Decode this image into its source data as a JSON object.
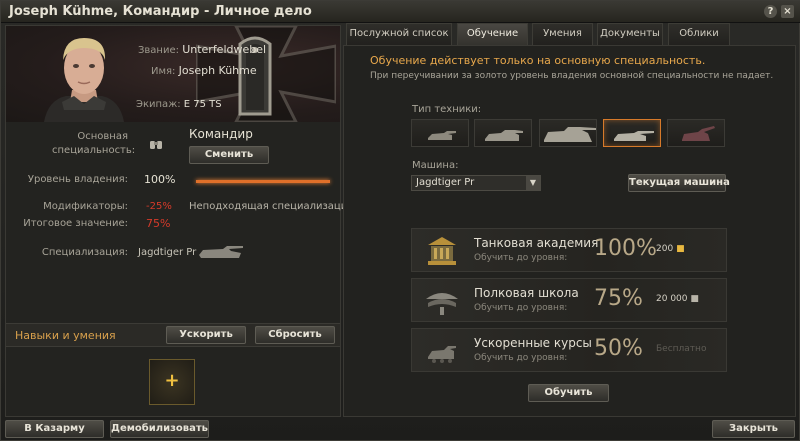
{
  "window": {
    "title": "Joseph Kühme, Командир - Личное дело",
    "help": "?",
    "close": "×"
  },
  "profile": {
    "rank_label": "Звание:",
    "rank": "Unterfeldwebel",
    "name_label": "Имя:",
    "name": "Joseph Kühme",
    "crew_label": "Экипаж:",
    "crew": "E 75 TS"
  },
  "specialty": {
    "label": "Основная специальность:",
    "value": "Командир",
    "change_button": "Сменить",
    "level_label": "Уровень владения:",
    "level": "100%",
    "level_fraction": 1.0,
    "modifiers_label": "Модификаторы:",
    "modifiers": "-25%",
    "modifier_note": "Неподходящая специализация",
    "final_label": "Итоговое значение:",
    "final": "75%",
    "spec_label": "Специализация:",
    "spec_vehicle": "Jagdtiger Pr"
  },
  "skills": {
    "title": "Навыки и умения",
    "accelerate": "Ускорить",
    "reset": "Сбросить",
    "add": "+"
  },
  "tabs": [
    "Послужной список",
    "Обучение",
    "Умения",
    "Документы",
    "Облики"
  ],
  "training": {
    "headline": "Обучение действует только на основную специальность.",
    "note": "При переучивании за золото уровень владения основной специальности не падает.",
    "vehicle_type_label": "Тип техники:",
    "vehicle_label": "Машина:",
    "vehicle": "Jagdtiger Pr",
    "current_vehicle_button": "Текущая машина",
    "options": [
      {
        "name": "Танковая академия",
        "sub": "Обучить до уровня:",
        "pct": "100%",
        "cost": "200",
        "currency": "gold"
      },
      {
        "name": "Полковая школа",
        "sub": "Обучить до уровня:",
        "pct": "75%",
        "cost": "20 000",
        "currency": "silver"
      },
      {
        "name": "Ускоренные курсы",
        "sub": "Обучить до уровня:",
        "pct": "50%",
        "cost": "Бесплатно",
        "currency": "free"
      }
    ],
    "train_button": "Обучить"
  },
  "footer": {
    "barracks": "В Казарму",
    "demobilize": "Демобилизовать",
    "close": "Закрыть"
  },
  "colors": {
    "accent": "#d77a2a",
    "warning": "#e8a84c",
    "negative": "#d63a2a",
    "text": "#c8c4b8"
  }
}
